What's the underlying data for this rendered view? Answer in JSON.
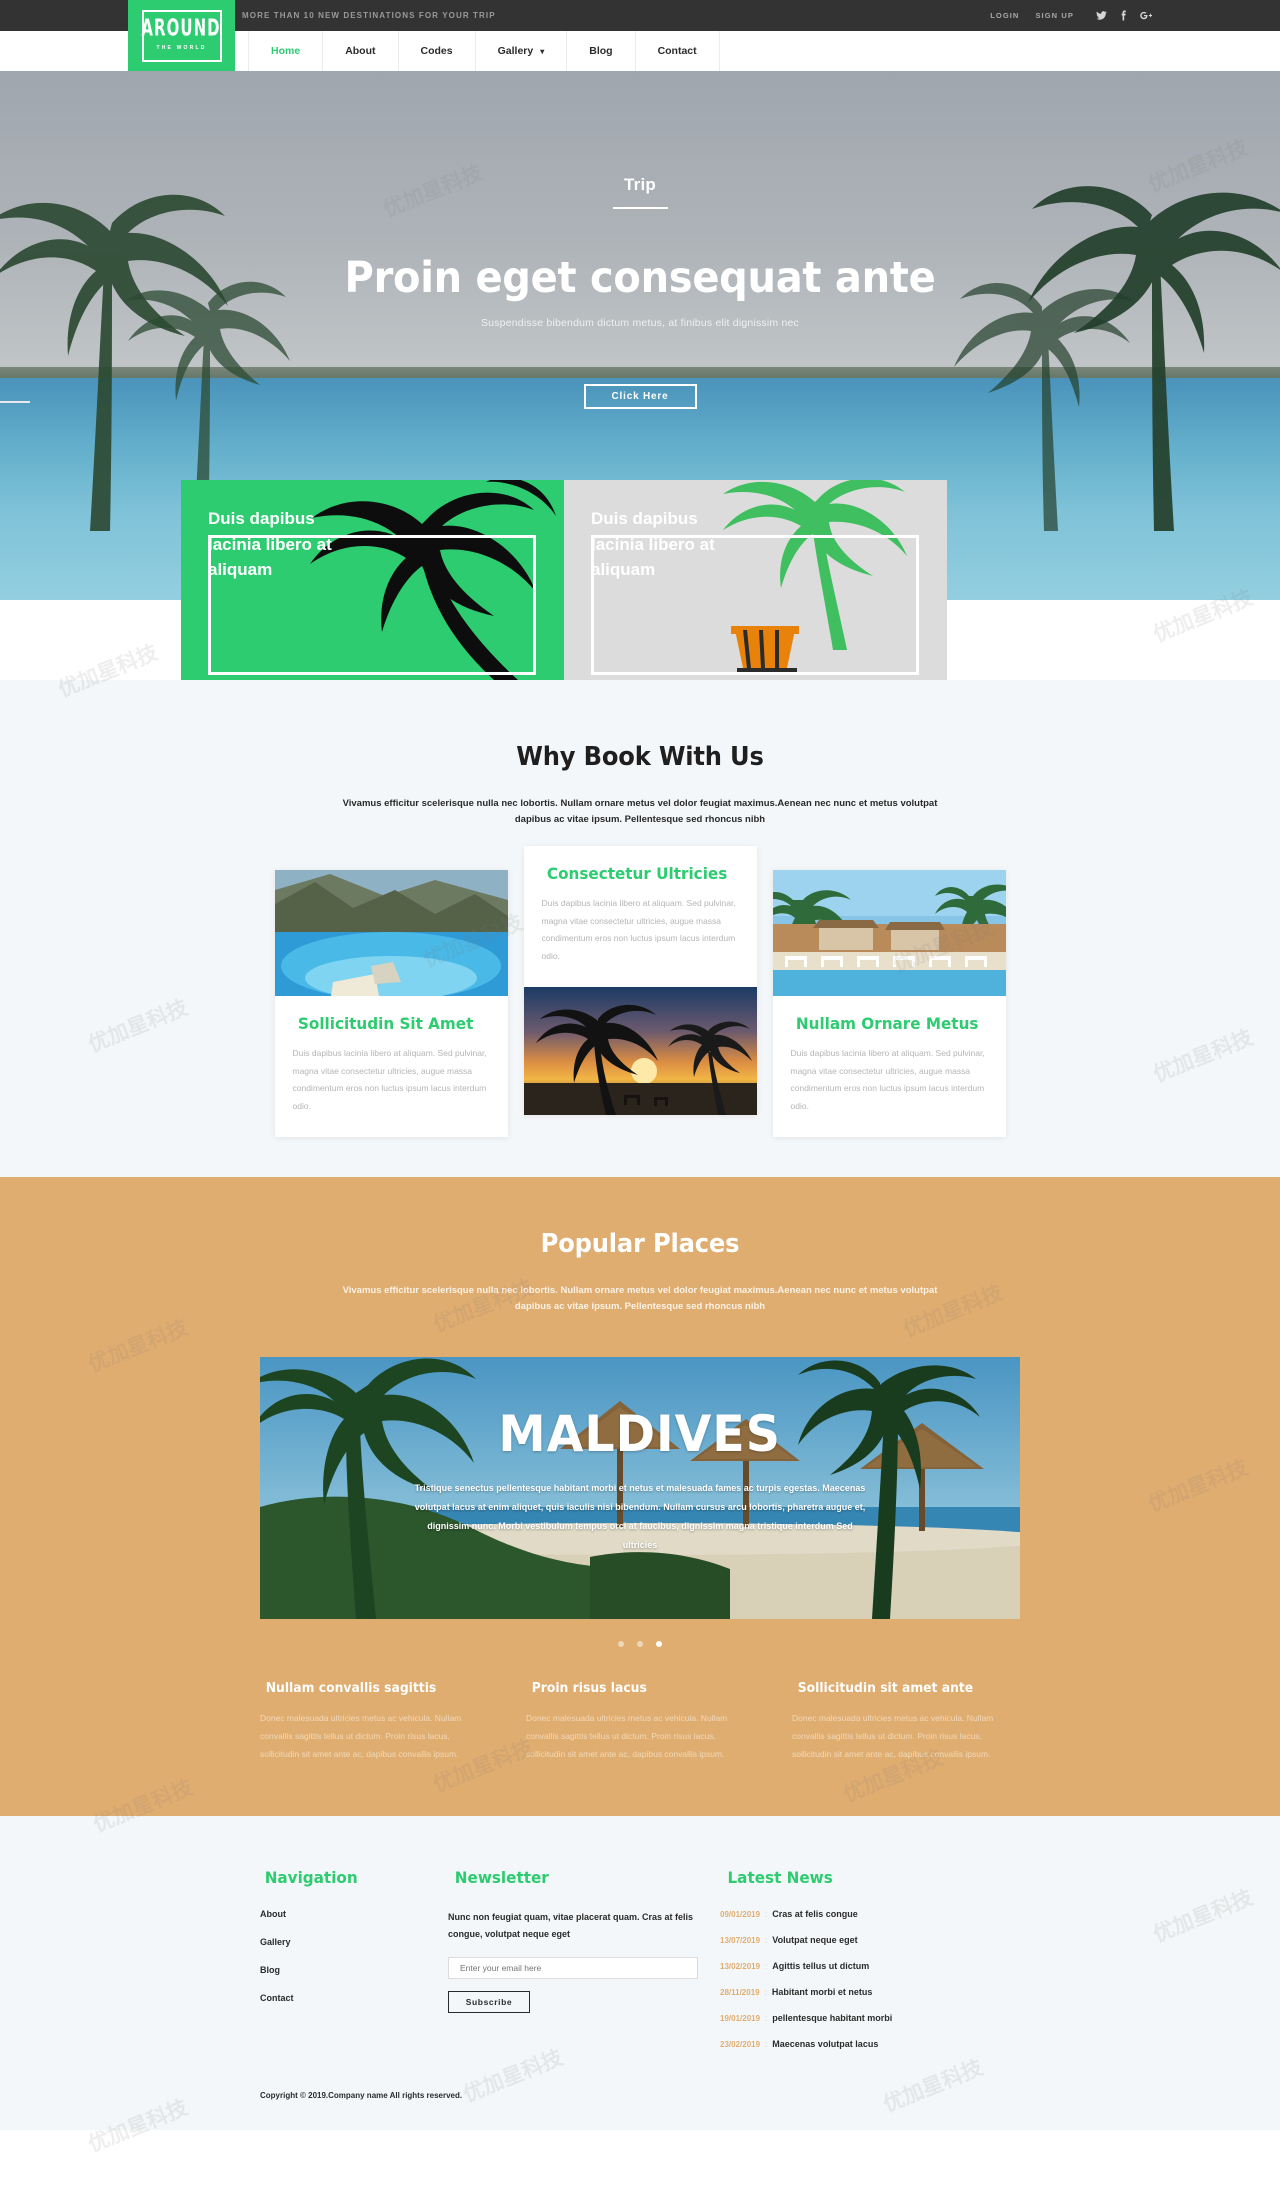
{
  "topbar": {
    "tagline": "MORE THAN 10 NEW DESTINATIONS FOR YOUR TRIP",
    "login": "LOGIN",
    "signup": "SIGN UP",
    "social": [
      "twitter-icon",
      "facebook-icon",
      "google-plus-icon"
    ]
  },
  "logo": {
    "main": "AROUND",
    "sub": "THE WORLD"
  },
  "nav": {
    "items": [
      {
        "label": "Home",
        "active": true,
        "caret": false
      },
      {
        "label": "About",
        "active": false,
        "caret": false
      },
      {
        "label": "Codes",
        "active": false,
        "caret": false
      },
      {
        "label": "Gallery",
        "active": false,
        "caret": true
      },
      {
        "label": "Blog",
        "active": false,
        "caret": false
      },
      {
        "label": "Contact",
        "active": false,
        "caret": false
      }
    ]
  },
  "hero": {
    "kicker": "Trip",
    "title": "Proin eget consequat ante",
    "subtitle": "Suspendisse bibendum dictum metus, at finibus elit dignissim nec",
    "button": "Click Here",
    "slides": 3,
    "active_slide": 3
  },
  "promos": [
    {
      "title": "Duis dapibus lacinia libero at aliquam",
      "theme": "green"
    },
    {
      "title": "Duis dapibus lacinia libero at aliquam",
      "theme": "grey"
    }
  ],
  "why": {
    "title": "Why Book With Us",
    "subtitle": "Vivamus efficitur scelerisque nulla nec lobortis. Nullam ornare metus vel dolor feugiat maximus.Aenean nec nunc et metus volutpat dapibus ac vitae ipsum. Pellentesque sed rhoncus nibh",
    "cards": [
      {
        "title": "Sollicitudin Sit Amet",
        "text": "Duis dapibus lacinia libero at aliquam. Sed pulvinar, magna vitae consectetur ultricies, augue massa condimentum eros non luctus ipsum lacus interdum odio.",
        "image": "zakynthos-navagio-beach-photo"
      },
      {
        "title": "Consectetur Ultricies",
        "text": "Duis dapibus lacinia libero at aliquam. Sed pulvinar, magna vitae consectetur ultricies, augue massa condimentum eros non luctus ipsum lacus interdum odio.",
        "image": "palm-sunset-beach-photo"
      },
      {
        "title": "Nullam Ornare Metus",
        "text": "Duis dapibus lacinia libero at aliquam. Sed pulvinar, magna vitae consectetur ultricies, augue massa condimentum eros non luctus ipsum lacus interdum odio.",
        "image": "tropical-resort-loungers-photo"
      }
    ]
  },
  "popular": {
    "title": "Popular Places",
    "subtitle": "Vivamus efficitur scelerisque nulla nec lobortis. Nullam ornare metus vel dolor feugiat maximus.Aenean nec nunc et metus volutpat dapibus ac vitae ipsum. Pellentesque sed rhoncus nibh",
    "feature": {
      "title": "MALDIVES",
      "text": "Tristique senectus pellentesque habitant morbi et netus et malesuada fames ac turpis egestas. Maecenas volutpat lacus at enim aliquet, quis iaculis nisi bibendum. Nullam cursus arcu lobortis, pharetra augue et, dignissim nunc. Morbi vestibulum tempus orci at faucibus, dignissim magna tristique interdum Sed ultricies",
      "slides": 3,
      "active_slide": 3
    },
    "columns": [
      {
        "title": "Nullam convallis sagittis",
        "text": "Donec malesuada ultricies metus ac vehicula. Nullam convallis sagittis tellus ut dictum. Proin risus lacus, sollicitudin sit amet ante ac, dapibus convallis ipsum."
      },
      {
        "title": "Proin risus lacus",
        "text": "Donec malesuada ultricies metus ac vehicula. Nullam convallis sagittis tellus ut dictum. Proin risus lacus, sollicitudin sit amet ante ac, dapibus convallis ipsum."
      },
      {
        "title": "Sollicitudin sit amet ante",
        "text": "Donec malesuada ultricies metus ac vehicula. Nullam convallis sagittis tellus ut dictum. Proin risus lacus, sollicitudin sit amet ante ac, dapibus convallis ipsum."
      }
    ]
  },
  "footer": {
    "navigation": {
      "title": "Navigation",
      "links": [
        "About",
        "Gallery",
        "Blog",
        "Contact"
      ]
    },
    "newsletter": {
      "title": "Newsletter",
      "text": "Nunc non feugiat quam, vitae placerat quam. Cras at felis congue, volutpat neque eget",
      "placeholder": "Enter your email here",
      "value": "",
      "button": "Subscribe"
    },
    "latest_news": {
      "title": "Latest News",
      "items": [
        {
          "date": "09/01/2019",
          "title": "Cras at felis congue"
        },
        {
          "date": "13/07/2019",
          "title": "Volutpat neque eget"
        },
        {
          "date": "13/02/2019",
          "title": "Agittis tellus ut dictum"
        },
        {
          "date": "28/11/2019",
          "title": "Habitant morbi et netus"
        },
        {
          "date": "19/01/2019",
          "title": "pellentesque habitant morbi"
        },
        {
          "date": "23/02/2019",
          "title": "Maecenas volutpat lacus"
        }
      ]
    },
    "copyright": "Copyright © 2019.Company name All rights reserved."
  },
  "colors": {
    "brand_green": "#2ecc71",
    "dark": "#333333",
    "sand": "#e0ad70",
    "light_bg": "#f4f7f9"
  },
  "watermark": "优加星科技"
}
